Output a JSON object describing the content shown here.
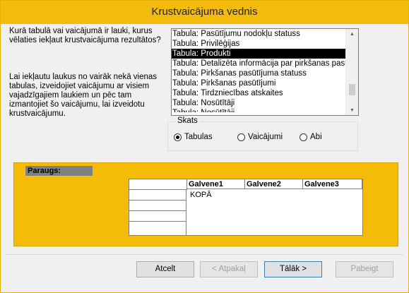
{
  "window": {
    "title": "Krustvaicājuma vednis"
  },
  "instructions": {
    "question": "Kurā tabulā vai vaicājumā ir lauki, kurus vēlaties iekļaut krustvaicājuma rezultātos?",
    "hint": "Lai iekļautu laukus no vairāk nekā vienas tabulas, izveidojiet vaicājumu ar visiem vajadzīgajiem laukiem un pēc tam izmantojiet šo vaicājumu, lai izveidotu krustvaicājumu."
  },
  "table_list": {
    "items": [
      "Tabula: Pasūtījumu nodokļu statuss",
      "Tabula: Privilēģijas",
      "Tabula: Produkti",
      "Tabula: Detalizēta informācija par pirkšanas pasūtījumu",
      "Tabula: Pirkšanas pasūtījuma statuss",
      "Tabula: Pirkšanas pasūtījumi",
      "Tabula: Tirdzniecības atskaites",
      "Tabula: Nosūtītāji",
      "Tabula: Nosūtītāji"
    ],
    "selected_index": 2
  },
  "view_group": {
    "label": "Skats",
    "options": [
      {
        "label": "Tabulas",
        "checked": true
      },
      {
        "label": "Vaicājumi",
        "checked": false
      },
      {
        "label": "Abi",
        "checked": false
      }
    ]
  },
  "preview": {
    "label": "Paraugs:",
    "headers": [
      "Galvene1",
      "Galvene2",
      "Galvene3"
    ],
    "cell_text": "KOPĀ"
  },
  "buttons": {
    "cancel": "Atcelt",
    "back": "< Atpakaļ",
    "next": "Tālāk >",
    "finish": "Pabeigt"
  }
}
